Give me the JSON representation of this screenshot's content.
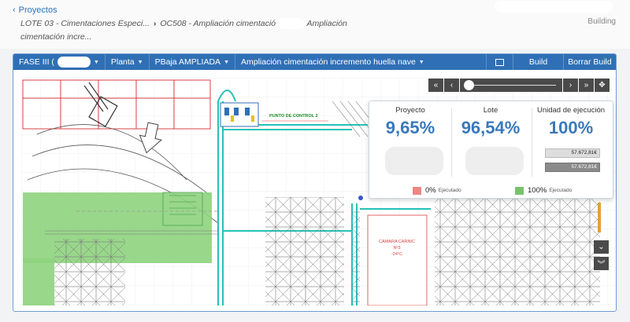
{
  "header": {
    "back_label": "Proyectos",
    "crumb1": "LOTE 03 - Cimentaciones Especi...",
    "crumb2": "OC508 - Ampliación cimentació",
    "crumb3": "Ampliación",
    "crumb4": "cimentación incre...",
    "building_label": "Building"
  },
  "toolbar": {
    "phase": "FASE III (",
    "view": "Planta",
    "level": "PBaja AMPLIADA",
    "task": "Ampliación cimentación incremento huella nave",
    "build_label": "Build",
    "clear_label": "Borrar Build"
  },
  "plan": {
    "control_point": "PUNTO DE CONTROL 2",
    "room_line1": "CAMARA CARNIC",
    "room_line2": "Nº3",
    "room_line3": "-24°C"
  },
  "stats": {
    "proyecto": {
      "title": "Proyecto",
      "value": "9,65%"
    },
    "lote": {
      "title": "Lote",
      "value": "96,54%"
    },
    "unidad": {
      "title": "Unidad de ejecución",
      "value": "100%",
      "amount1": "57.672,81€",
      "amount2": "57.672,81€"
    }
  },
  "legend": [
    {
      "value": "0%",
      "label": "Ejecutado",
      "color": "#ef8585"
    },
    {
      "value": "100%",
      "label": "Ejecutado",
      "color": "#77c36c"
    }
  ],
  "zoom_slider": {
    "position": 0.03
  },
  "colors": {
    "accent": "#2f6fb5",
    "percent": "#3a79bb",
    "slider_accent": "#e0a23a"
  }
}
